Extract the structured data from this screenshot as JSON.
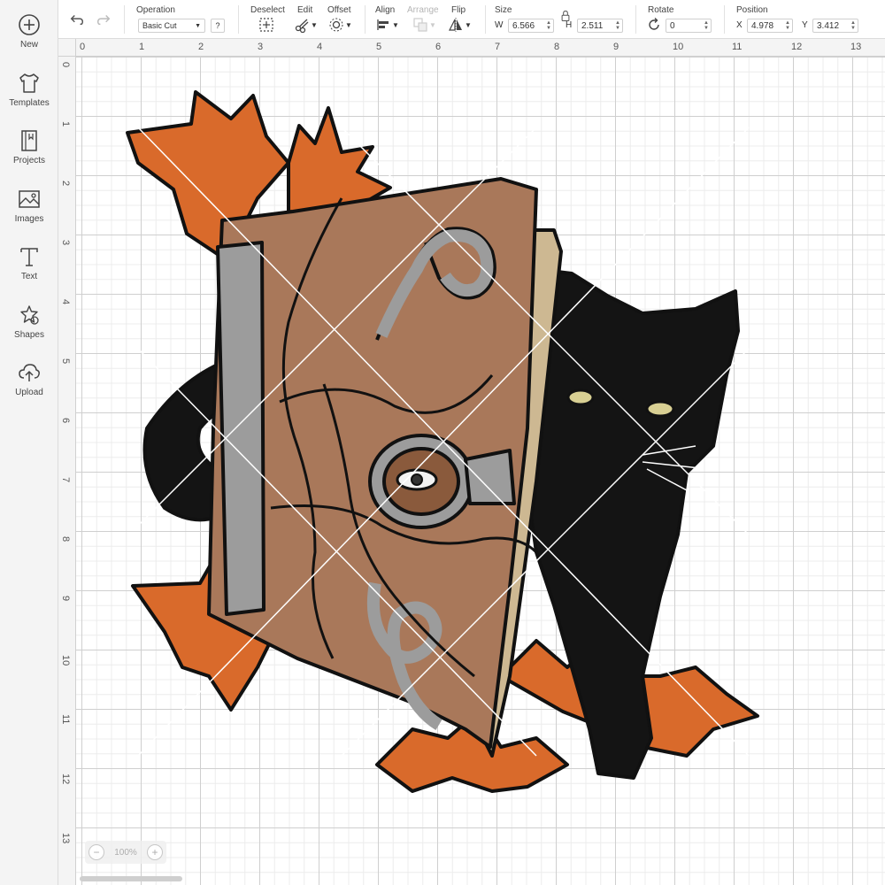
{
  "sidebar": {
    "items": [
      {
        "label": "New",
        "icon": "plus-circle-icon"
      },
      {
        "label": "Templates",
        "icon": "tshirt-icon"
      },
      {
        "label": "Projects",
        "icon": "notebook-icon"
      },
      {
        "label": "Images",
        "icon": "image-icon"
      },
      {
        "label": "Text",
        "icon": "text-icon"
      },
      {
        "label": "Shapes",
        "icon": "shapes-icon"
      },
      {
        "label": "Upload",
        "icon": "cloud-upload-icon"
      }
    ]
  },
  "toolbar": {
    "operation": {
      "label": "Operation",
      "value": "Basic Cut",
      "help": "?"
    },
    "deselect": {
      "label": "Deselect"
    },
    "edit": {
      "label": "Edit"
    },
    "offset": {
      "label": "Offset"
    },
    "align": {
      "label": "Align"
    },
    "arrange": {
      "label": "Arrange"
    },
    "flip": {
      "label": "Flip"
    },
    "size": {
      "label": "Size",
      "w_prefix": "W",
      "w_value": "6.566",
      "h_prefix": "H",
      "h_value": "2.511"
    },
    "rotate": {
      "label": "Rotate",
      "value": "0"
    },
    "position": {
      "label": "Position",
      "x_prefix": "X",
      "x_value": "4.978",
      "y_prefix": "Y",
      "y_value": "3.412"
    }
  },
  "rulers": {
    "top": [
      "0",
      "1",
      "2",
      "3",
      "4",
      "5",
      "6",
      "7",
      "8",
      "9",
      "10",
      "11",
      "12",
      "13"
    ],
    "left": [
      "0",
      "1",
      "2",
      "3",
      "4",
      "5",
      "6",
      "7",
      "8",
      "9",
      "10",
      "11",
      "12",
      "13"
    ]
  },
  "zoom": {
    "minus": "−",
    "value": "100%",
    "plus": "+"
  },
  "colors": {
    "leaf_orange": "#d96a2b",
    "book_brown": "#a9785a",
    "page_tan": "#cdb892",
    "metal_gray": "#9c9c9c",
    "cat_black": "#141414",
    "cat_eye": "#d8cf93",
    "outline": "#111111"
  }
}
